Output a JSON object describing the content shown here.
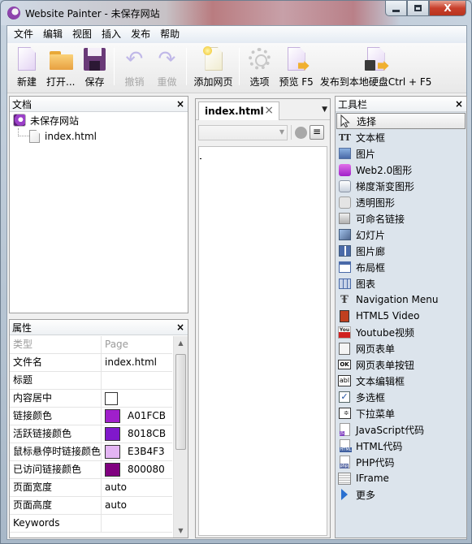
{
  "window": {
    "title": "Website Painter - 未保存网站",
    "controls": {
      "minimize": "—",
      "maximize": "□",
      "close": "X"
    }
  },
  "menu": [
    "文件",
    "编辑",
    "视图",
    "插入",
    "发布",
    "帮助"
  ],
  "toolbar": {
    "new": "新建",
    "open": "打开...",
    "save": "保存",
    "undo": "撤销",
    "redo": "重做",
    "add_page": "添加网页",
    "options": "选项",
    "preview": "预览 F5",
    "publish_local": "发布到本地硬盘Ctrl + F5"
  },
  "doc_panel": {
    "title": "文档",
    "close": "×",
    "tree": {
      "root": "未保存网站",
      "children": [
        "index.html"
      ]
    }
  },
  "props_panel": {
    "title": "属性",
    "close": "×",
    "header": {
      "key": "类型",
      "value": "Page"
    },
    "rows": [
      {
        "key": "文件名",
        "value": "index.html"
      },
      {
        "key": "标题",
        "value": ""
      },
      {
        "key": "内容居中",
        "value": "",
        "checkbox": true
      },
      {
        "key": "链接颜色",
        "value": "A01FCB",
        "color": "#A01FCB"
      },
      {
        "key": "活跃链接颜色",
        "value": "8018CB",
        "color": "#8018CB"
      },
      {
        "key": "鼠标悬停时链接颜色",
        "value": "E3B4F3",
        "color": "#E3B4F3"
      },
      {
        "key": "已访问链接颜色",
        "value": "800080",
        "color": "#800080"
      },
      {
        "key": "页面宽度",
        "value": "auto"
      },
      {
        "key": "页面高度",
        "value": "auto"
      },
      {
        "key": "Keywords",
        "value": ""
      }
    ]
  },
  "editor": {
    "tab_label": "index.html",
    "tab_close": "×",
    "tab_menu": "▼",
    "combo_value": ""
  },
  "tools_panel": {
    "title": "工具栏",
    "close": "×",
    "items": [
      {
        "label": "选择",
        "icon": "cursor-icon",
        "selected": true
      },
      {
        "label": "文本框",
        "icon": "text-icon"
      },
      {
        "label": "图片",
        "icon": "image-icon"
      },
      {
        "label": "Web2.0图形",
        "icon": "web2-shape-icon"
      },
      {
        "label": "梯度渐变图形",
        "icon": "gradient-shape-icon"
      },
      {
        "label": "透明图形",
        "icon": "transparent-shape-icon"
      },
      {
        "label": "可命名链接",
        "icon": "named-link-icon"
      },
      {
        "label": "幻灯片",
        "icon": "slideshow-icon"
      },
      {
        "label": "图片廊",
        "icon": "gallery-icon"
      },
      {
        "label": "布局框",
        "icon": "layout-box-icon"
      },
      {
        "label": "图表",
        "icon": "table-icon"
      },
      {
        "label": "Navigation Menu",
        "icon": "navigation-menu-icon"
      },
      {
        "label": "HTML5 Video",
        "icon": "html5-video-icon"
      },
      {
        "label": "Youtube视频",
        "icon": "youtube-icon"
      },
      {
        "label": "网页表单",
        "icon": "form-icon"
      },
      {
        "label": "网页表单按钮",
        "icon": "form-button-icon"
      },
      {
        "label": "文本编辑框",
        "icon": "text-input-icon"
      },
      {
        "label": "多选框",
        "icon": "checkbox-icon"
      },
      {
        "label": "下拉菜单",
        "icon": "dropdown-icon"
      },
      {
        "label": "JavaScript代码",
        "icon": "javascript-code-icon"
      },
      {
        "label": "HTML代码",
        "icon": "html-code-icon"
      },
      {
        "label": "PHP代码",
        "icon": "php-code-icon"
      },
      {
        "label": "IFrame",
        "icon": "iframe-icon"
      },
      {
        "label": "更多",
        "icon": "more-icon"
      }
    ]
  }
}
